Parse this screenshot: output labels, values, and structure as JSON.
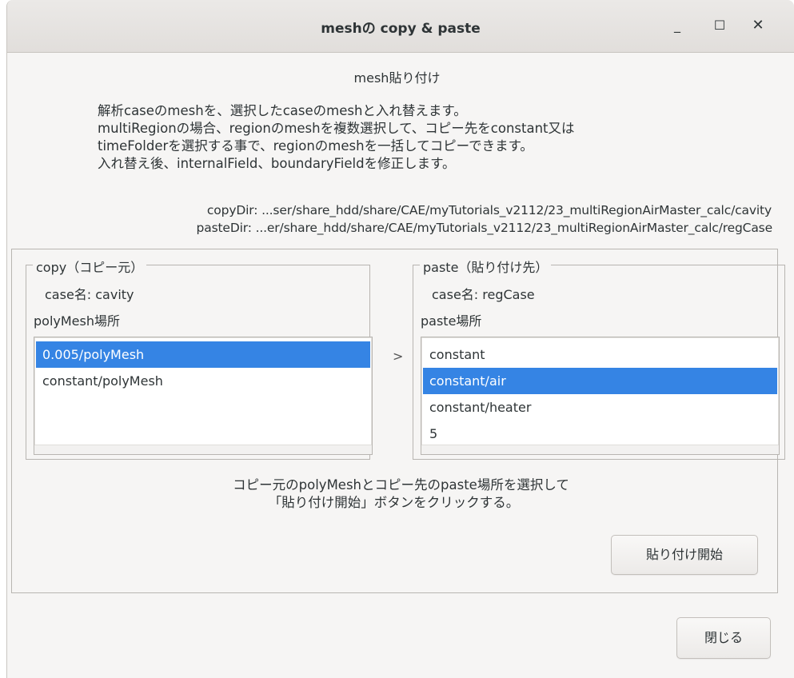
{
  "window": {
    "title": "meshの copy & paste",
    "controls": {
      "minimize": "_",
      "maximize": "☐",
      "close": "✕"
    }
  },
  "heading": "mesh貼り付け",
  "description": [
    "解析caseのmeshを、選択したcaseのmeshと入れ替えます。",
    "multiRegionの場合、regionのmeshを複数選択して、コピー先をconstant又は",
    "timeFolderを選択する事で、regionのmeshを一括してコピーできます。",
    "入れ替え後、internalField、boundaryFieldを修正します。"
  ],
  "dirs": {
    "copyDir": "copyDir: ...ser/share_hdd/share/CAE/myTutorials_v2112/23_multiRegionAirMaster_calc/cavity",
    "pasteDir": "pasteDir: ...er/share_hdd/share/CAE/myTutorials_v2112/23_multiRegionAirMaster_calc/regCase"
  },
  "copy": {
    "legend": "copy（コピー元）",
    "case_name": "case名: cavity",
    "location_label": "polyMesh場所",
    "items": [
      {
        "label": "0.005/polyMesh",
        "selected": true
      },
      {
        "label": "constant/polyMesh",
        "selected": false
      }
    ]
  },
  "arrow": ">",
  "paste": {
    "legend": "paste（貼り付け先）",
    "case_name": "case名: regCase",
    "location_label": "paste場所",
    "items": [
      {
        "label": "constant",
        "selected": false
      },
      {
        "label": "constant/air",
        "selected": true
      },
      {
        "label": "constant/heater",
        "selected": false
      },
      {
        "label": "5",
        "selected": false
      }
    ]
  },
  "instruction": [
    "コピー元のpolyMeshとコピー先のpaste場所を選択して",
    "「貼り付け開始」ボタンをクリックする。"
  ],
  "buttons": {
    "start": "貼り付け開始",
    "close": "閉じる"
  },
  "colors": {
    "selection": "#3584e4",
    "window_bg": "#f6f5f4"
  }
}
